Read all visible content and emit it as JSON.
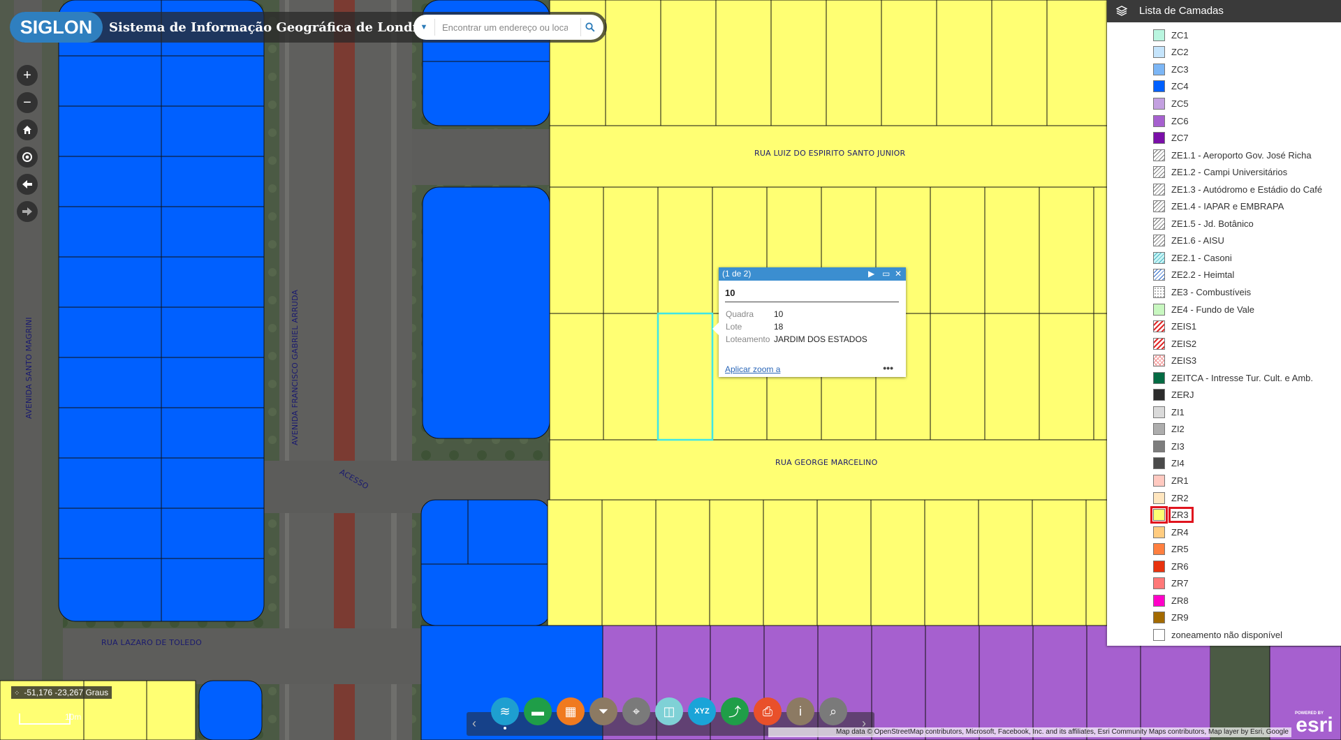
{
  "header": {
    "logo_text": "SIGLON",
    "app_title": "Sistema de Informação Geográfica de Londrina",
    "search_placeholder": "Encontrar um endereço ou local"
  },
  "map": {
    "streets": {
      "luiz": "RUA LUIZ DO ESPIRITO SANTO JUNIOR",
      "george": "RUA GEORGE MARCELINO",
      "lazaro": "RUA LAZARO DE TOLEDO",
      "santo_magrini": "AVENIDA SANTO MAGRINI",
      "francisco": "AVENIDA FRANCISCO GABRIEL ARRUDA",
      "acesso": "ACESSO"
    },
    "coordinates": "-51,176 -23,267 Graus",
    "scale": "10m",
    "attribution": "Map data © OpenStreetMap contributors, Microsoft, Facebook, Inc. and its affiliates, Esri Community Maps contributors, Map layer by Esri, Google"
  },
  "nav": {
    "zoom_in": "+",
    "zoom_out": "−"
  },
  "popup": {
    "pager": "(1 de 2)",
    "title": "10",
    "fields": [
      {
        "key": "Quadra",
        "value": "10"
      },
      {
        "key": "Lote",
        "value": "18"
      },
      {
        "key": "Loteamento",
        "value": "JARDIM DOS ESTADOS"
      }
    ],
    "zoom_link": "Aplicar zoom a",
    "more": "•••"
  },
  "layer_panel": {
    "title": "Lista de Camadas",
    "items": [
      {
        "label": "ZC1",
        "color": "#b9f5df"
      },
      {
        "label": "ZC2",
        "color": "#c5e4fb"
      },
      {
        "label": "ZC3",
        "color": "#7cb6f5"
      },
      {
        "label": "ZC4",
        "color": "#0060ff"
      },
      {
        "label": "ZC5",
        "color": "#c3a0e0"
      },
      {
        "label": "ZC6",
        "color": "#a660cf"
      },
      {
        "label": "ZC7",
        "color": "#7a0fa8"
      },
      {
        "label": "ZE1.1 - Aeroporto Gov. José Richa",
        "pattern": "hatch-gray"
      },
      {
        "label": "ZE1.2 - Campi Universitários",
        "pattern": "hatch-gray"
      },
      {
        "label": "ZE1.3 - Autódromo e Estádio do Café",
        "pattern": "hatch-gray"
      },
      {
        "label": "ZE1.4 - IAPAR e EMBRAPA",
        "pattern": "hatch-gray"
      },
      {
        "label": "ZE1.5 - Jd. Botânico",
        "pattern": "hatch-gray"
      },
      {
        "label": "ZE1.6 - AISU",
        "pattern": "hatch-gray"
      },
      {
        "label": "ZE2.1 - Casoni",
        "pattern": "hatch-cyan"
      },
      {
        "label": "ZE2.2 - Heimtal",
        "pattern": "hatch-blue"
      },
      {
        "label": "ZE3 - Combustíveis",
        "pattern": "dots"
      },
      {
        "label": "ZE4 - Fundo de Vale",
        "color": "#c8f7c0"
      },
      {
        "label": "ZEIS1",
        "pattern": "hatch-red"
      },
      {
        "label": "ZEIS2",
        "pattern": "hatch-red"
      },
      {
        "label": "ZEIS3",
        "pattern": "cross-pink"
      },
      {
        "label": "ZEITCA - Intresse Tur. Cult. e Amb.",
        "color": "#046b43"
      },
      {
        "label": "ZERJ",
        "color": "#2c2c2c"
      },
      {
        "label": "ZI1",
        "color": "#dadada"
      },
      {
        "label": "ZI2",
        "color": "#adadad"
      },
      {
        "label": "ZI3",
        "color": "#7d7d7d"
      },
      {
        "label": "ZI4",
        "color": "#4a4a4a"
      },
      {
        "label": "ZR1",
        "color": "#ffc9c0"
      },
      {
        "label": "ZR2",
        "color": "#ffe6bf"
      },
      {
        "label": "ZR3",
        "color": "#ffff73",
        "highlighted": true
      },
      {
        "label": "ZR4",
        "color": "#ffcc80"
      },
      {
        "label": "ZR5",
        "color": "#ff7f3f"
      },
      {
        "label": "ZR6",
        "color": "#e8320e"
      },
      {
        "label": "ZR7",
        "color": "#ff7878"
      },
      {
        "label": "ZR8",
        "color": "#ff00c8"
      },
      {
        "label": "ZR9",
        "color": "#a36a00"
      },
      {
        "label": "zoneamento não disponível",
        "color": "#ffffff"
      }
    ]
  },
  "toolbar": {
    "tools": [
      {
        "name": "layers-tool",
        "color": "#1e9fd0",
        "glyph": "≋"
      },
      {
        "name": "measure-tool",
        "color": "#1f9e48",
        "glyph": "▬"
      },
      {
        "name": "basemap-tool",
        "color": "#f07a1f",
        "glyph": "▦"
      },
      {
        "name": "filter-tool",
        "color": "#8c7a63",
        "glyph": "⏷"
      },
      {
        "name": "location-tool",
        "color": "#7a7a7a",
        "glyph": "⌖"
      },
      {
        "name": "swipe-tool",
        "color": "#7fd1d6",
        "glyph": "◫"
      },
      {
        "name": "xyz-tool",
        "color": "#1aa4d8",
        "glyph": "XYZ"
      },
      {
        "name": "share-tool",
        "color": "#1f9e48",
        "glyph": "⤴"
      },
      {
        "name": "print-tool",
        "color": "#e9502a",
        "glyph": "⎙"
      },
      {
        "name": "about-tool",
        "color": "#8c7a63",
        "glyph": "i"
      },
      {
        "name": "query-tool",
        "color": "#7a7a7a",
        "glyph": "⌕"
      }
    ]
  }
}
